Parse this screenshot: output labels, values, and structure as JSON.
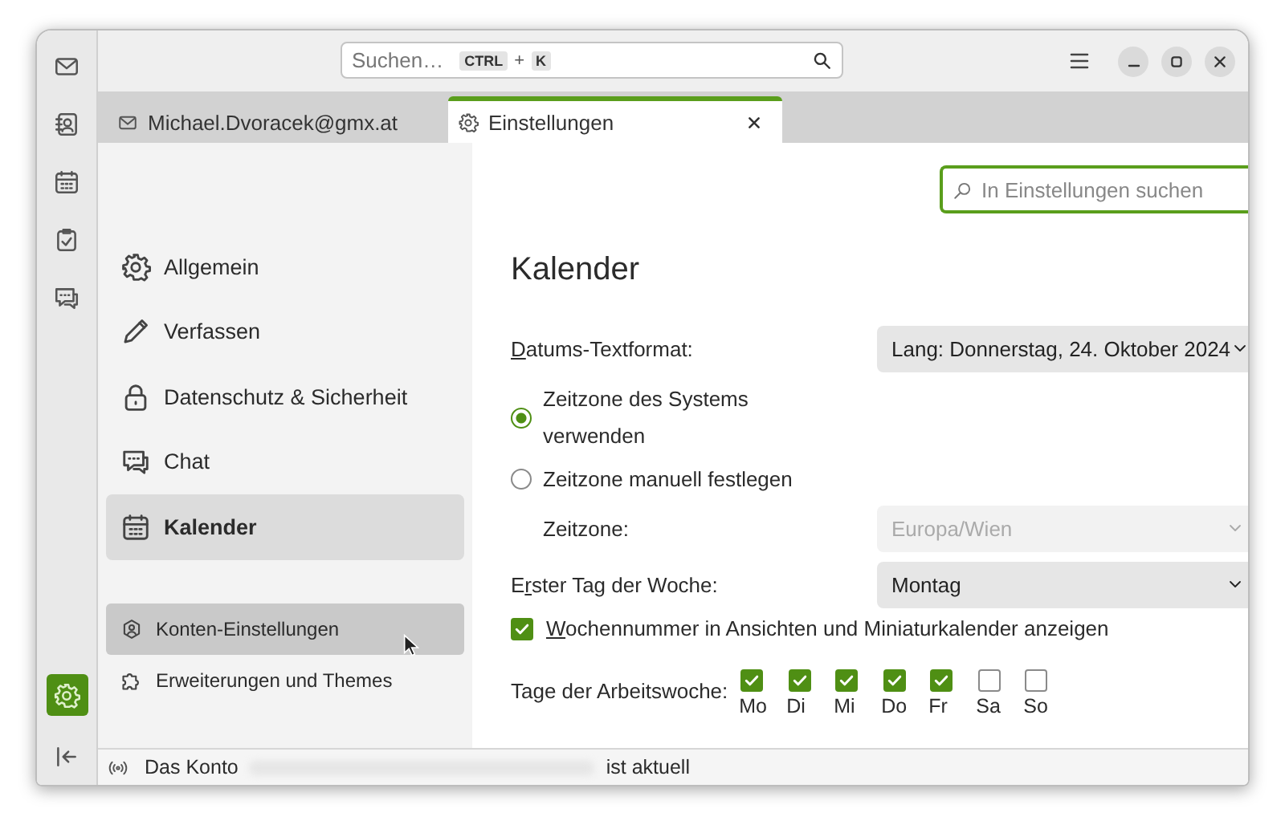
{
  "spaces": [
    {
      "selected": false
    },
    {
      "selected": false
    },
    {
      "selected": false
    },
    {
      "selected": false
    },
    {
      "selected": false
    }
  ],
  "spaces_bottom": [
    {
      "selected": true
    },
    {
      "selected": false
    }
  ],
  "search": {
    "placeholder": "Suchen…",
    "keys": [
      "CTRL",
      "K"
    ],
    "joiner": "+"
  },
  "tabs": [
    {
      "label": "Michael.Dvoracek@gmx.at",
      "selected": false
    },
    {
      "label": "Einstellungen",
      "selected": true
    }
  ],
  "settings_search": {
    "placeholder": "In Einstellungen suchen"
  },
  "categories": [
    {
      "label": "Allgemein",
      "selected": false
    },
    {
      "label": "Verfassen",
      "selected": false
    },
    {
      "label": "Datenschutz & Sicherheit",
      "selected": false
    },
    {
      "label": "Chat",
      "selected": false
    },
    {
      "label": "Kalender",
      "selected": true
    }
  ],
  "account_links": [
    {
      "label": "Konten-Einstellungen",
      "hovered": true
    },
    {
      "label": "Erweiterungen und Themes",
      "hovered": false
    }
  ],
  "section_title": "Kalender",
  "date_format": {
    "label": "Datums-Textformat:",
    "value": "Lang: Donnerstag, 24. Oktober 2024",
    "disabled": false
  },
  "timezone_options": [
    {
      "label": "Zeitzone des Systems verwenden",
      "selected": true
    },
    {
      "label": "Zeitzone manuell festlegen",
      "selected": false
    }
  ],
  "timezone": {
    "label": "Zeitzone:",
    "value": "Europa/Wien",
    "disabled": true
  },
  "first_day": {
    "label": "Erster Tag der Woche:",
    "value": "Montag",
    "disabled": false
  },
  "week_numbers": {
    "label": "Wochennummer in Ansichten und Miniaturkalender anzeigen",
    "checked": true
  },
  "workweek": {
    "label": "Tage der Arbeitswoche:",
    "days": [
      {
        "label": "Mo",
        "checked": true
      },
      {
        "label": "Di",
        "checked": true
      },
      {
        "label": "Mi",
        "checked": true
      },
      {
        "label": "Do",
        "checked": true
      },
      {
        "label": "Fr",
        "checked": true
      },
      {
        "label": "Sa",
        "checked": false
      },
      {
        "label": "So",
        "checked": false
      }
    ]
  },
  "status": {
    "prefix": "Das Konto",
    "suffix": "ist aktuell"
  }
}
